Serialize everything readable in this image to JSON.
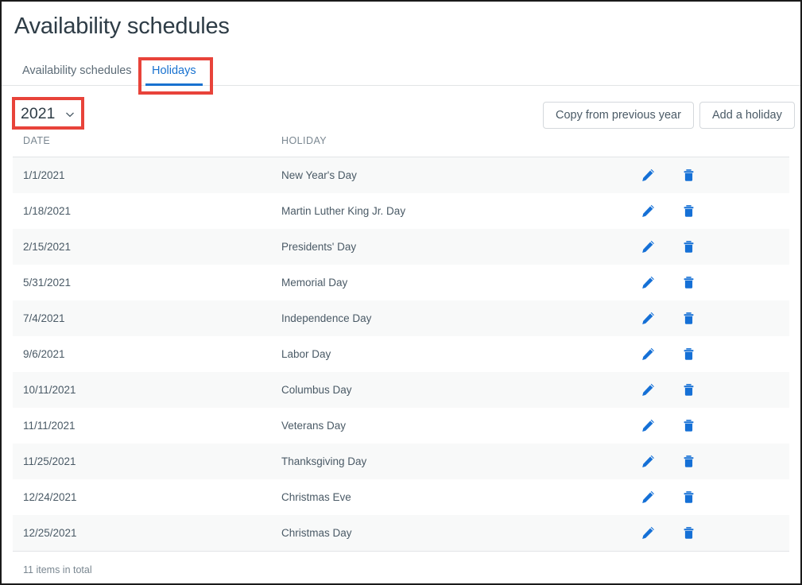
{
  "page": {
    "title": "Availability schedules"
  },
  "tabs": [
    {
      "label": "Availability schedules",
      "active": false
    },
    {
      "label": "Holidays",
      "active": true
    }
  ],
  "toolbar": {
    "year_value": "2021",
    "year_chevron_icon": "chevron-down-icon",
    "copy_button_label": "Copy from previous year",
    "add_button_label": "Add a holiday"
  },
  "table": {
    "columns": [
      "DATE",
      "HOLIDAY"
    ],
    "row_action_icons": [
      "pencil-icon",
      "trash-icon"
    ],
    "rows": [
      {
        "date": "1/1/2021",
        "holiday": "New Year's Day"
      },
      {
        "date": "1/18/2021",
        "holiday": "Martin Luther King Jr. Day"
      },
      {
        "date": "2/15/2021",
        "holiday": "Presidents' Day"
      },
      {
        "date": "5/31/2021",
        "holiday": "Memorial Day"
      },
      {
        "date": "7/4/2021",
        "holiday": "Independence Day"
      },
      {
        "date": "9/6/2021",
        "holiday": "Labor Day"
      },
      {
        "date": "10/11/2021",
        "holiday": "Columbus Day"
      },
      {
        "date": "11/11/2021",
        "holiday": "Veterans Day"
      },
      {
        "date": "11/25/2021",
        "holiday": "Thanksgiving Day"
      },
      {
        "date": "12/24/2021",
        "holiday": "Christmas Eve"
      },
      {
        "date": "12/25/2021",
        "holiday": "Christmas Day"
      }
    ],
    "footer_text": "11 items in total"
  },
  "colors": {
    "accent_blue": "#1872d0",
    "icon_blue": "#1570d6",
    "annotation_red": "#e8433a",
    "text_primary": "#2e3c46",
    "text_secondary": "#4a5a66",
    "text_muted": "#7a8791",
    "row_alt_bg": "#f8f9f9",
    "border": "#e2e4e6"
  }
}
